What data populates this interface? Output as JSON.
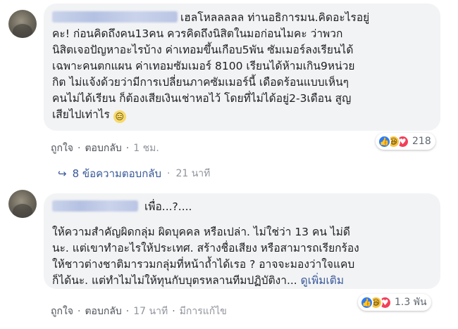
{
  "comment1": {
    "text_intro": "เฮลโหลลลลล ท่านอธิการมน.คิดอะไรอยู่",
    "text_body": "คะ! ก่อนคิดถึงคน13คน ควรคิดถึงนิสิตในมอก่อนไมคะ ว่าพวก\nนิสิตเจอปัญหาอะไรบ้าง ค่าเทอมขึ้นเกือบ5พัน ซัมเมอร์ลงเรียนได้\nเฉพาะคนตกแผน ค่าเทอมซัมเมอร์ 8100 เรียนได้ห้ามเกิน9หน่วย\nกิต ไม่แจ้งด้วยว่ามีการเปลี่ยนภาคซัมเมอร์นี้ เดือดร้อนแบบเห็นๆ\nคนไม่ได้เรียน ก็ต้องเสียเงินเช่าหอไว้ โดยที่ไม่ได้อยู่2-3เดือน สูญ\nเสียไปเท่าไร",
    "emoji": "😑",
    "like_label": "ถูกใจ",
    "reply_label": "ตอบกลับ",
    "time": "1 ชม.",
    "reaction_count": "218"
  },
  "replies_summary": {
    "arrow": "↪",
    "label": "8 ข้อความตอบกลับ",
    "time": "21 นาที"
  },
  "comment2": {
    "text_intro": "เพื่อ...?....",
    "text_body": "ให้ความสำคัญผิดกลุ่ม ผิดบุคคล หรือเปล่า. ไม่ใช่ว่า 13 คน ไม่ดี\nนะ. แต่เขาทำอะไรให้ประเทศ. สร้างชื่อเสียง หรือสามารถเรียกร้อง\nให้ชาวต่างชาติมารวมกลุ่มที่หน้าถ้ำได้เรอ ? อาจจะมองว่าใจแคบ\nก็ได้นะ. แต่ทำไมไม่ให้ทุนกับบุตรหลานทีมปฏิบัติงา...",
    "see_more": "ดูเพิ่มเติม",
    "like_label": "ถูกใจ",
    "reply_label": "ตอบกลับ",
    "time": "17 นาที",
    "edited_label": "มีการแก้ไข",
    "reaction_count": "1.3 พัน"
  },
  "separator": "·",
  "reaction_icons": [
    "like-icon",
    "haha-icon",
    "love-icon"
  ],
  "colors": {
    "link": "#385898",
    "muted": "#90949c",
    "bubble": "#f2f3f5",
    "like": "#2d7bf4",
    "love": "#f33e58",
    "haha": "#f7c543"
  }
}
